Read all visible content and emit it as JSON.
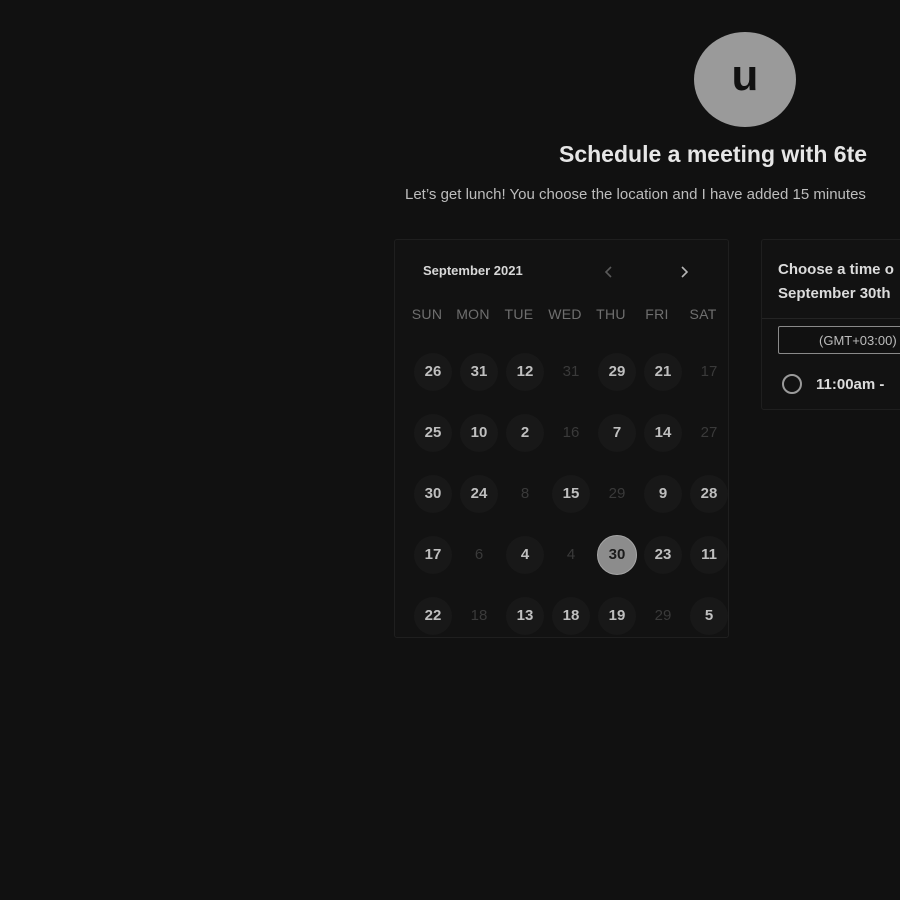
{
  "host": {
    "avatar_letter": "u",
    "title": "Schedule a meeting with 6te",
    "description": "Let’s get lunch! You choose the location and I have added 15 minutes"
  },
  "calendar": {
    "month_label": "September 2021",
    "prev_icon": "chevron-left-icon",
    "next_icon": "chevron-right-icon",
    "weekdays": [
      "SUN",
      "MON",
      "TUE",
      "WED",
      "THU",
      "FRI",
      "SAT"
    ],
    "weeks": [
      [
        {
          "label": "26",
          "available": true
        },
        {
          "label": "31",
          "available": true
        },
        {
          "label": "12",
          "available": true
        },
        {
          "label": "31",
          "available": false
        },
        {
          "label": "29",
          "available": true
        },
        {
          "label": "21",
          "available": true
        },
        {
          "label": "17",
          "available": false
        }
      ],
      [
        {
          "label": "25",
          "available": true
        },
        {
          "label": "10",
          "available": true
        },
        {
          "label": "2",
          "available": true
        },
        {
          "label": "16",
          "available": false
        },
        {
          "label": "7",
          "available": true
        },
        {
          "label": "14",
          "available": true
        },
        {
          "label": "27",
          "available": false
        }
      ],
      [
        {
          "label": "30",
          "available": true
        },
        {
          "label": "24",
          "available": true
        },
        {
          "label": "8",
          "available": false
        },
        {
          "label": "15",
          "available": true
        },
        {
          "label": "29",
          "available": false
        },
        {
          "label": "9",
          "available": true
        },
        {
          "label": "28",
          "available": true
        }
      ],
      [
        {
          "label": "17",
          "available": true
        },
        {
          "label": "6",
          "available": false
        },
        {
          "label": "4",
          "available": true
        },
        {
          "label": "4",
          "available": false
        },
        {
          "label": "30",
          "available": true,
          "selected": true
        },
        {
          "label": "23",
          "available": true
        },
        {
          "label": "11",
          "available": true
        }
      ],
      [
        {
          "label": "22",
          "available": true
        },
        {
          "label": "18",
          "available": false
        },
        {
          "label": "13",
          "available": true
        },
        {
          "label": "18",
          "available": true
        },
        {
          "label": "19",
          "available": true
        },
        {
          "label": "29",
          "available": false
        },
        {
          "label": "5",
          "available": true
        }
      ]
    ]
  },
  "time_panel": {
    "heading_line1": "Choose a time o",
    "heading_line2": "September 30th",
    "timezone": "(GMT+03:00)",
    "slots": [
      {
        "label": "11:00am -"
      }
    ]
  },
  "colors": {
    "background": "#111111",
    "avatar": "#9a9a9a",
    "selected_day": "#8c8c8c"
  }
}
